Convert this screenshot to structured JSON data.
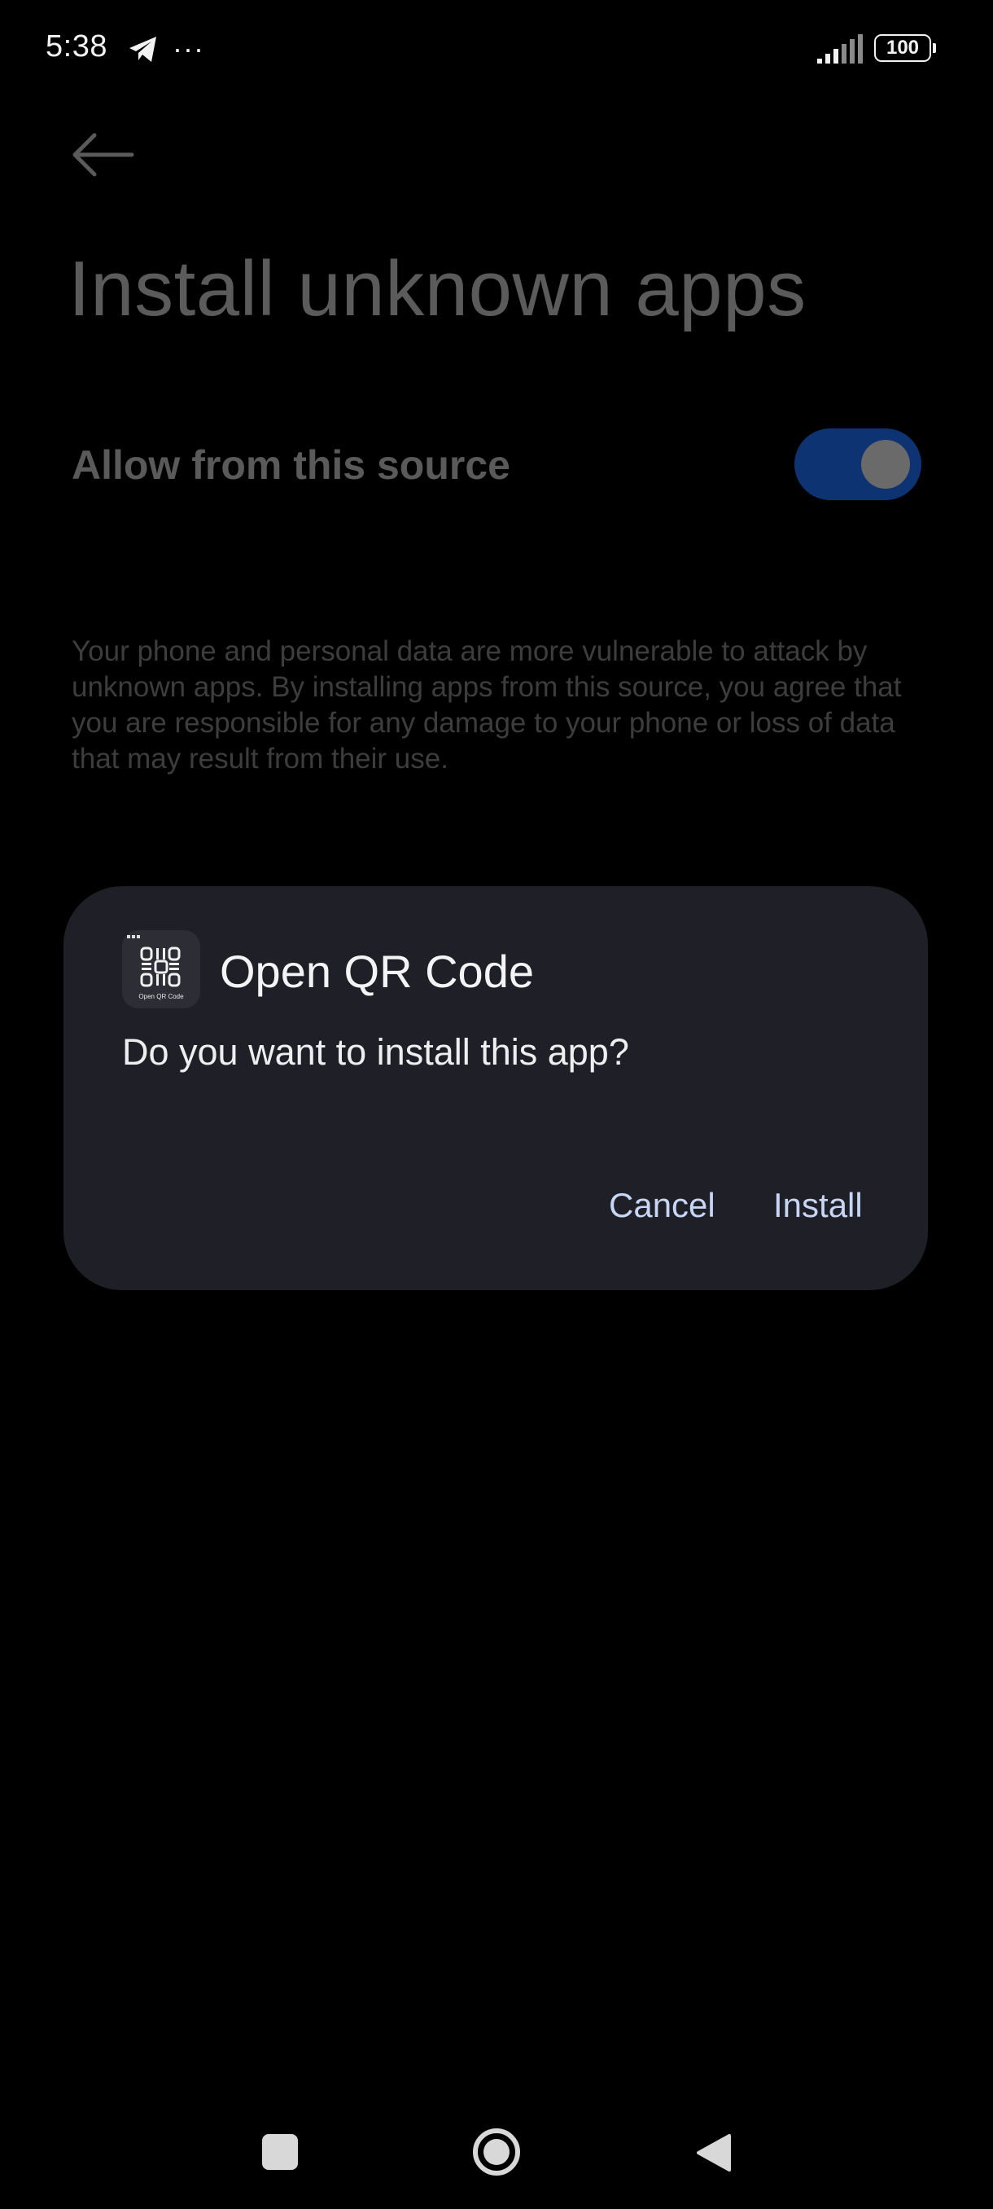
{
  "status_bar": {
    "time": "5:38",
    "battery_level": "100",
    "icons": [
      "telegram-icon",
      "more-dots-icon",
      "signal-icon",
      "battery-icon"
    ],
    "more_dots": "···"
  },
  "settings_page": {
    "title": "Install unknown apps",
    "allow_label": "Allow from this source",
    "allow_toggle_on": true,
    "warning": "Your phone and personal data are more vulnerable to attack by unknown apps. By installing apps from this source, you agree that you are responsible for any damage to your phone or loss of data that may result from their use."
  },
  "dialog": {
    "app_name": "Open QR Code",
    "message": "Do you want to install this app?",
    "cancel_label": "Cancel",
    "install_label": "Install",
    "app_icon_caption": "Open QR Code"
  },
  "colors": {
    "background": "#000000",
    "dialog_background": "#1f2027",
    "button_text": "#c7d6f5",
    "toggle_track": "#0e3372"
  },
  "nav_bar": {
    "icons": [
      "recents-icon",
      "home-icon",
      "back-icon"
    ]
  }
}
